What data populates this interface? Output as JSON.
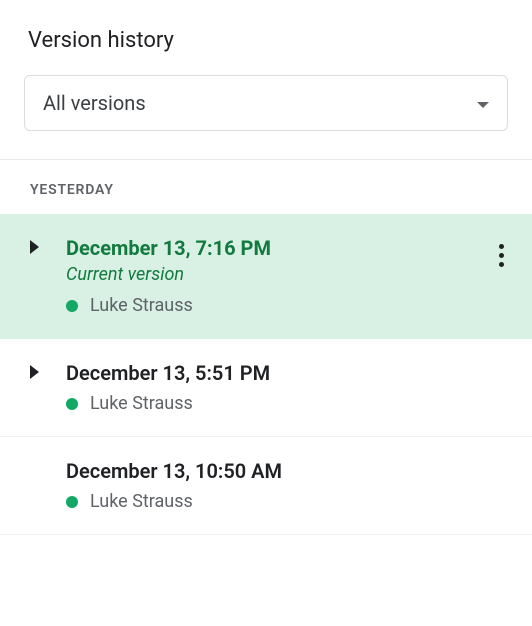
{
  "panel": {
    "title": "Version history",
    "filter": {
      "selected": "All versions"
    },
    "sections": [
      {
        "label": "YESTERDAY",
        "items": [
          {
            "timestamp": "December 13, 7:16 PM",
            "subtitle": "Current version",
            "editor": "Luke Strauss",
            "editor_color": "#14a866",
            "selected": true,
            "expandable": true,
            "show_overflow": true
          },
          {
            "timestamp": "December 13, 5:51 PM",
            "editor": "Luke Strauss",
            "editor_color": "#14a866",
            "selected": false,
            "expandable": true,
            "show_overflow": false
          },
          {
            "timestamp": "December 13, 10:50 AM",
            "editor": "Luke Strauss",
            "editor_color": "#14a866",
            "selected": false,
            "expandable": false,
            "show_overflow": false
          }
        ]
      }
    ]
  }
}
